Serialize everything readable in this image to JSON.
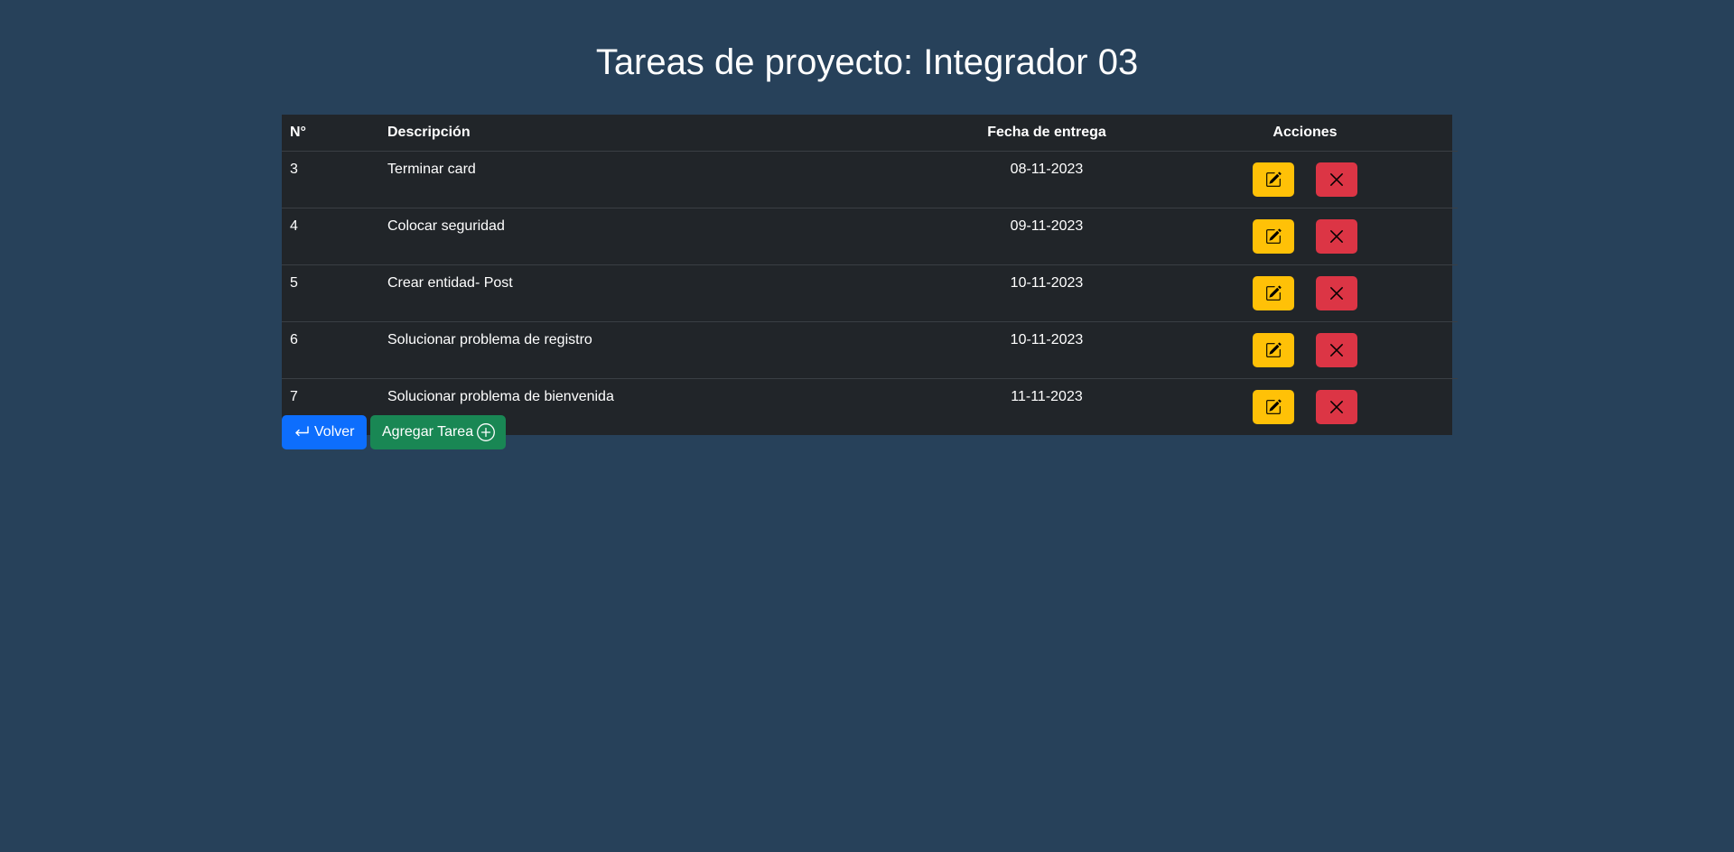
{
  "page": {
    "title": "Tareas de proyecto: Integrador 03"
  },
  "table": {
    "headers": {
      "num": "N°",
      "description": "Descripción",
      "due_date": "Fecha de entrega",
      "actions": "Acciones"
    },
    "rows": [
      {
        "num": "3",
        "description": "Terminar card",
        "due_date": "08-11-2023"
      },
      {
        "num": "4",
        "description": "Colocar seguridad",
        "due_date": "09-11-2023"
      },
      {
        "num": "5",
        "description": "Crear entidad- Post",
        "due_date": "10-11-2023"
      },
      {
        "num": "6",
        "description": "Solucionar problema de registro",
        "due_date": "10-11-2023"
      },
      {
        "num": "7",
        "description": "Solucionar problema de bienvenida",
        "due_date": "11-11-2023"
      }
    ],
    "row_actions": {
      "edit_icon": "pencil-square-icon",
      "delete_icon": "x-icon"
    }
  },
  "buttons": {
    "back_label": "Volver",
    "back_icon": "return-arrow-icon",
    "add_label": "Agregar Tarea",
    "add_icon": "plus-circle-icon"
  },
  "colors": {
    "background": "#27415a",
    "table_bg": "#212529",
    "edit": "#ffc107",
    "delete": "#dc3545",
    "primary": "#0d6efd",
    "success": "#198754"
  }
}
